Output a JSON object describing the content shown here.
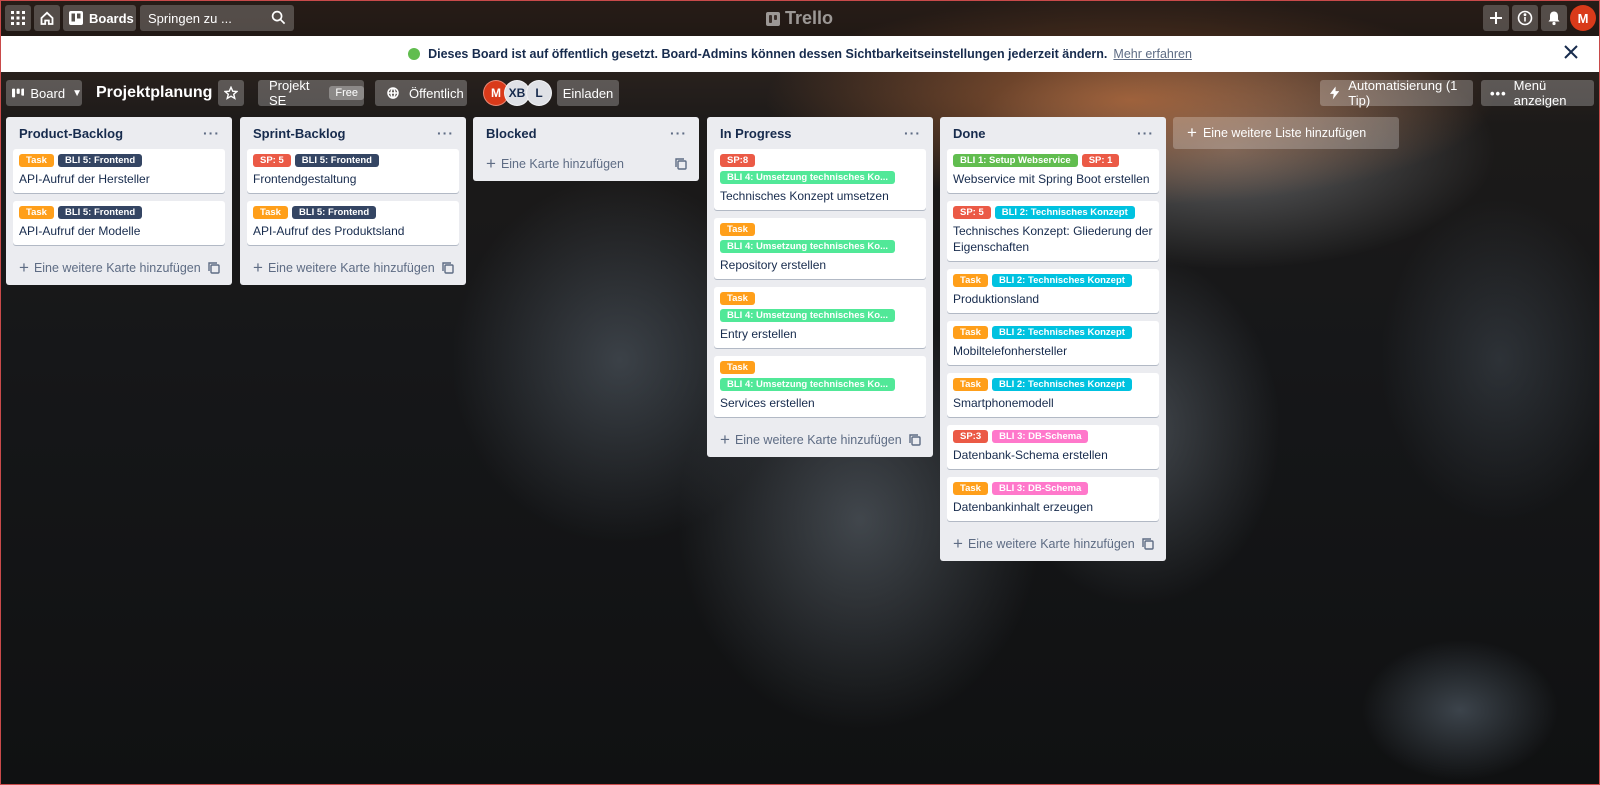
{
  "header": {
    "boards_label": "Boards",
    "search_placeholder": "Springen zu ...",
    "logo_text": "Trello",
    "user_initial": "M"
  },
  "banner": {
    "message": "Dieses Board ist auf öffentlich gesetzt. Board-Admins können dessen Sichtbarkeitseinstellungen jederzeit ändern.",
    "link": "Mehr erfahren"
  },
  "board_bar": {
    "view_label": "Board",
    "title": "Projektplanung",
    "workspace": "Projekt SE",
    "workspace_badge": "Free",
    "visibility": "Öffentlich",
    "members": [
      {
        "initials": "M",
        "color": "#d93a1a"
      },
      {
        "initials": "XB",
        "color": "#dfe1e6"
      },
      {
        "initials": "L",
        "color": "#dfe1e6"
      }
    ],
    "invite_label": "Einladen",
    "automation_label": "Automatisierung (1 Tip)",
    "menu_label": "Menü anzeigen"
  },
  "colors": {
    "orange": "#ff9f1a",
    "navy": "#344563",
    "red": "#eb5a46",
    "green": "#51e898",
    "lime": "#61bd4f",
    "sky": "#00c2e0",
    "pink": "#ff78cb"
  },
  "lists": [
    {
      "title": "Product-Backlog",
      "cards": [
        {
          "labels": [
            {
              "text": "Task",
              "color": "orange"
            },
            {
              "text": "BLI 5: Frontend",
              "color": "navy"
            }
          ],
          "title": "API-Aufruf der Hersteller"
        },
        {
          "labels": [
            {
              "text": "Task",
              "color": "orange"
            },
            {
              "text": "BLI 5: Frontend",
              "color": "navy"
            }
          ],
          "title": "API-Aufruf der Modelle"
        }
      ],
      "add_card": "Eine weitere Karte hinzufügen"
    },
    {
      "title": "Sprint-Backlog",
      "cards": [
        {
          "labels": [
            {
              "text": "SP: 5",
              "color": "red"
            },
            {
              "text": "BLI 5: Frontend",
              "color": "navy"
            }
          ],
          "title": "Frontendgestaltung"
        },
        {
          "labels": [
            {
              "text": "Task",
              "color": "orange"
            },
            {
              "text": "BLI 5: Frontend",
              "color": "navy"
            }
          ],
          "title": "API-Aufruf des Produktsland"
        }
      ],
      "add_card": "Eine weitere Karte hinzufügen"
    },
    {
      "title": "Blocked",
      "cards": [],
      "add_card": "Eine Karte hinzufügen"
    },
    {
      "title": "In Progress",
      "cards": [
        {
          "labels": [
            {
              "text": "SP:8",
              "color": "red"
            },
            {
              "text": "BLI 4: Umsetzung technisches Ko...",
              "color": "green"
            }
          ],
          "title": "Technisches Konzept umsetzen"
        },
        {
          "labels": [
            {
              "text": "Task",
              "color": "orange"
            },
            {
              "text": "BLI 4: Umsetzung technisches Ko...",
              "color": "green"
            }
          ],
          "title": "Repository erstellen"
        },
        {
          "labels": [
            {
              "text": "Task",
              "color": "orange"
            },
            {
              "text": "BLI 4: Umsetzung technisches Ko...",
              "color": "green"
            }
          ],
          "title": "Entry erstellen"
        },
        {
          "labels": [
            {
              "text": "Task",
              "color": "orange"
            },
            {
              "text": "BLI 4: Umsetzung technisches Ko...",
              "color": "green"
            }
          ],
          "title": "Services erstellen"
        }
      ],
      "add_card": "Eine weitere Karte hinzufügen"
    },
    {
      "title": "Done",
      "cards": [
        {
          "labels": [
            {
              "text": "BLI 1: Setup Webservice",
              "color": "lime"
            },
            {
              "text": "SP: 1",
              "color": "red"
            }
          ],
          "title": "Webservice mit Spring Boot erstellen"
        },
        {
          "labels": [
            {
              "text": "SP: 5",
              "color": "red"
            },
            {
              "text": "BLI 2: Technisches Konzept",
              "color": "sky"
            }
          ],
          "title": "Technisches Konzept: Gliederung der Eigenschaften"
        },
        {
          "labels": [
            {
              "text": "Task",
              "color": "orange"
            },
            {
              "text": "BLI 2: Technisches Konzept",
              "color": "sky"
            }
          ],
          "title": "Produktionsland"
        },
        {
          "labels": [
            {
              "text": "Task",
              "color": "orange"
            },
            {
              "text": "BLI 2: Technisches Konzept",
              "color": "sky"
            }
          ],
          "title": "Mobiltelefonhersteller"
        },
        {
          "labels": [
            {
              "text": "Task",
              "color": "orange"
            },
            {
              "text": "BLI 2: Technisches Konzept",
              "color": "sky"
            }
          ],
          "title": "Smartphonemodell"
        },
        {
          "labels": [
            {
              "text": "SP:3",
              "color": "red"
            },
            {
              "text": "BLI 3: DB-Schema",
              "color": "pink"
            }
          ],
          "title": "Datenbank-Schema erstellen"
        },
        {
          "labels": [
            {
              "text": "Task",
              "color": "orange"
            },
            {
              "text": "BLI 3: DB-Schema",
              "color": "pink"
            }
          ],
          "title": "Datenbankinhalt erzeugen"
        }
      ],
      "add_card": "Eine weitere Karte hinzufügen"
    }
  ],
  "add_list": "Eine weitere Liste hinzufügen"
}
